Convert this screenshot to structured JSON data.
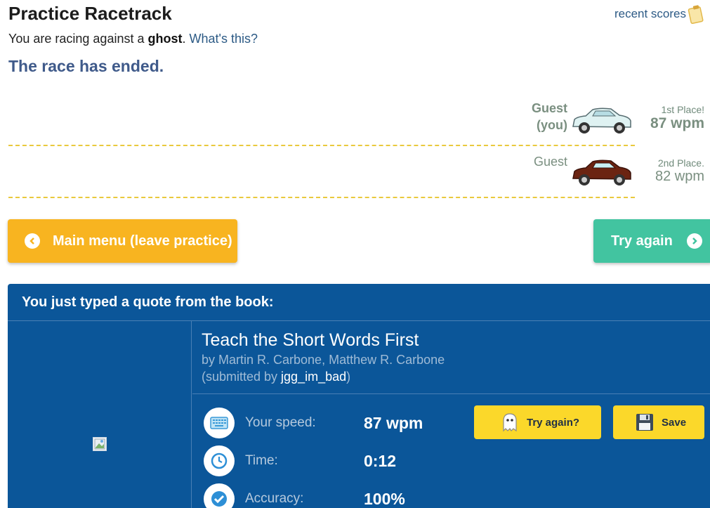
{
  "header": {
    "title": "Practice Racetrack",
    "recent_scores": "recent scores"
  },
  "intro": {
    "prefix": "You are racing against a ",
    "ghost": "ghost",
    "period": ".",
    "whats_this": "What's this?"
  },
  "status": "The race has ended.",
  "race": {
    "lanes": [
      {
        "name": "Guest",
        "you_label": "(you)",
        "place": "1st Place!",
        "wpm": "87 wpm",
        "car_color": "#dff2f2"
      },
      {
        "name": "Guest",
        "place": "2nd Place.",
        "wpm": "82 wpm",
        "car_color": "#6b2412"
      }
    ]
  },
  "buttons": {
    "main_menu": "Main menu (leave practice)",
    "try_again": "Try again"
  },
  "quote_panel": {
    "heading": "You just typed a quote from the book:",
    "book_title": "Teach the Short Words First",
    "by": "by Martin R. Carbone, Matthew R. Carbone",
    "submitted_prefix": "(submitted by ",
    "submitted_user": "jgg_im_bad",
    "submitted_suffix": ")",
    "stats": [
      {
        "label": "Your speed:",
        "value": "87 wpm",
        "icon": "keyboard-icon"
      },
      {
        "label": "Time:",
        "value": "0:12",
        "icon": "clock-icon"
      },
      {
        "label": "Accuracy:",
        "value": "100%",
        "icon": "checkmark-icon"
      }
    ],
    "try_again_ghost": "Try again?",
    "save": "Save"
  },
  "colors": {
    "accent_orange": "#f8b420",
    "accent_green": "#42c4a0",
    "panel_blue": "#0b5699",
    "button_yellow": "#fbd82a",
    "status_text": "#3f5a8a"
  }
}
